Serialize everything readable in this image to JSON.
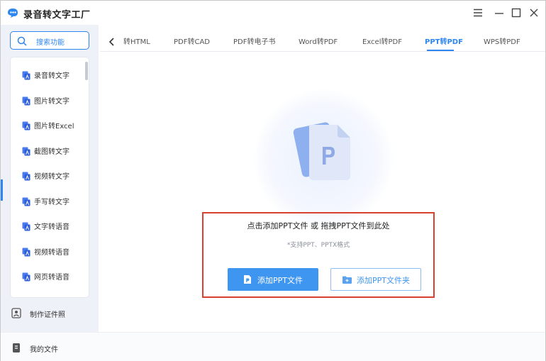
{
  "app": {
    "title": "录音转文字工厂"
  },
  "sidebar": {
    "search_label": "搜索功能",
    "items": [
      {
        "label": "录音转文字",
        "icon": "translate-icon"
      },
      {
        "label": "图片转文字",
        "icon": "translate-icon"
      },
      {
        "label": "图片转Excel",
        "icon": "translate-icon"
      },
      {
        "label": "截图转文字",
        "icon": "translate-icon"
      },
      {
        "label": "视频转文字",
        "icon": "translate-icon"
      },
      {
        "label": "手写转文字",
        "icon": "translate-icon"
      },
      {
        "label": "文字转语音",
        "icon": "translate-icon"
      },
      {
        "label": "视频转语音",
        "icon": "translate-icon"
      },
      {
        "label": "网页转语音",
        "icon": "translate-icon"
      }
    ],
    "id_photo_label": "制作证件照",
    "my_files_label": "我的文件"
  },
  "tabs": {
    "items": [
      "转HTML",
      "PDF转CAD",
      "PDF转电子书",
      "Word转PDF",
      "Excel转PDF",
      "PPT转PDF",
      "WPS转PDF"
    ],
    "active": "PPT转PDF"
  },
  "upload": {
    "title": "点击添加PPT文件 或 拖拽PPT文件到此处",
    "hint": "*支持PPT、PPTX格式",
    "add_file_button": "添加PPT文件",
    "add_folder_button": "添加PPT文件夹"
  },
  "colors": {
    "accent": "#2e86f0",
    "button": "#3f96f1",
    "highlight_border": "#d9412f",
    "sidebar_bg": "#eef2f8"
  }
}
